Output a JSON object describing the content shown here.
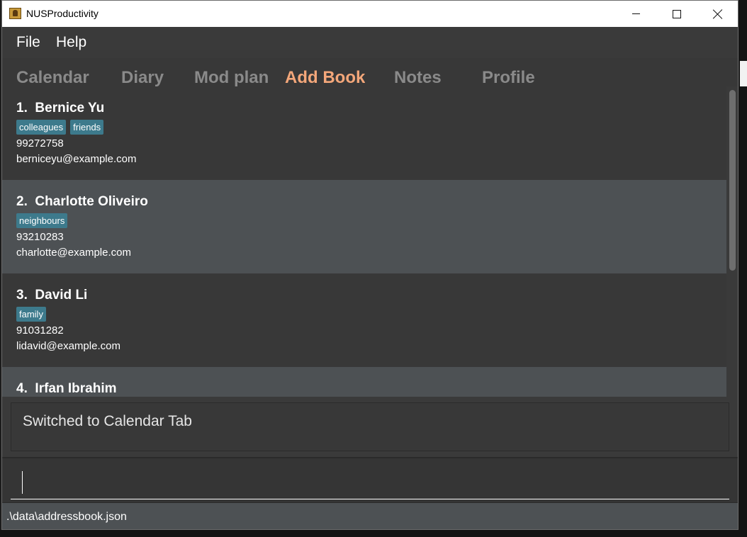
{
  "window": {
    "title": "NUSProductivity"
  },
  "menu": {
    "items": [
      "File",
      "Help"
    ]
  },
  "tabs": [
    {
      "label": "Calendar",
      "active": false
    },
    {
      "label": "Diary",
      "active": false
    },
    {
      "label": "Mod plan",
      "active": false
    },
    {
      "label": "Add Book",
      "active": true
    },
    {
      "label": "Notes",
      "active": false
    },
    {
      "label": "Profile",
      "active": false
    }
  ],
  "colors": {
    "active_tab": "#f4a77a",
    "inactive_tab": "#8a8a8a",
    "tag_background": "#3d7a8c"
  },
  "contacts": [
    {
      "index": "1.",
      "name": "Bernice Yu",
      "tags": [
        "colleagues",
        "friends"
      ],
      "phone": "99272758",
      "email": "berniceyu@example.com"
    },
    {
      "index": "2.",
      "name": "Charlotte Oliveiro",
      "tags": [
        "neighbours"
      ],
      "phone": "93210283",
      "email": "charlotte@example.com"
    },
    {
      "index": "3.",
      "name": "David Li",
      "tags": [
        "family"
      ],
      "phone": "91031282",
      "email": "lidavid@example.com"
    },
    {
      "index": "4.",
      "name": "Irfan Ibrahim",
      "tags": [],
      "phone": "",
      "email": ""
    }
  ],
  "result": {
    "message": "Switched to Calendar Tab"
  },
  "command": {
    "value": ""
  },
  "status": {
    "file_path": ".\\data\\addressbook.json"
  }
}
